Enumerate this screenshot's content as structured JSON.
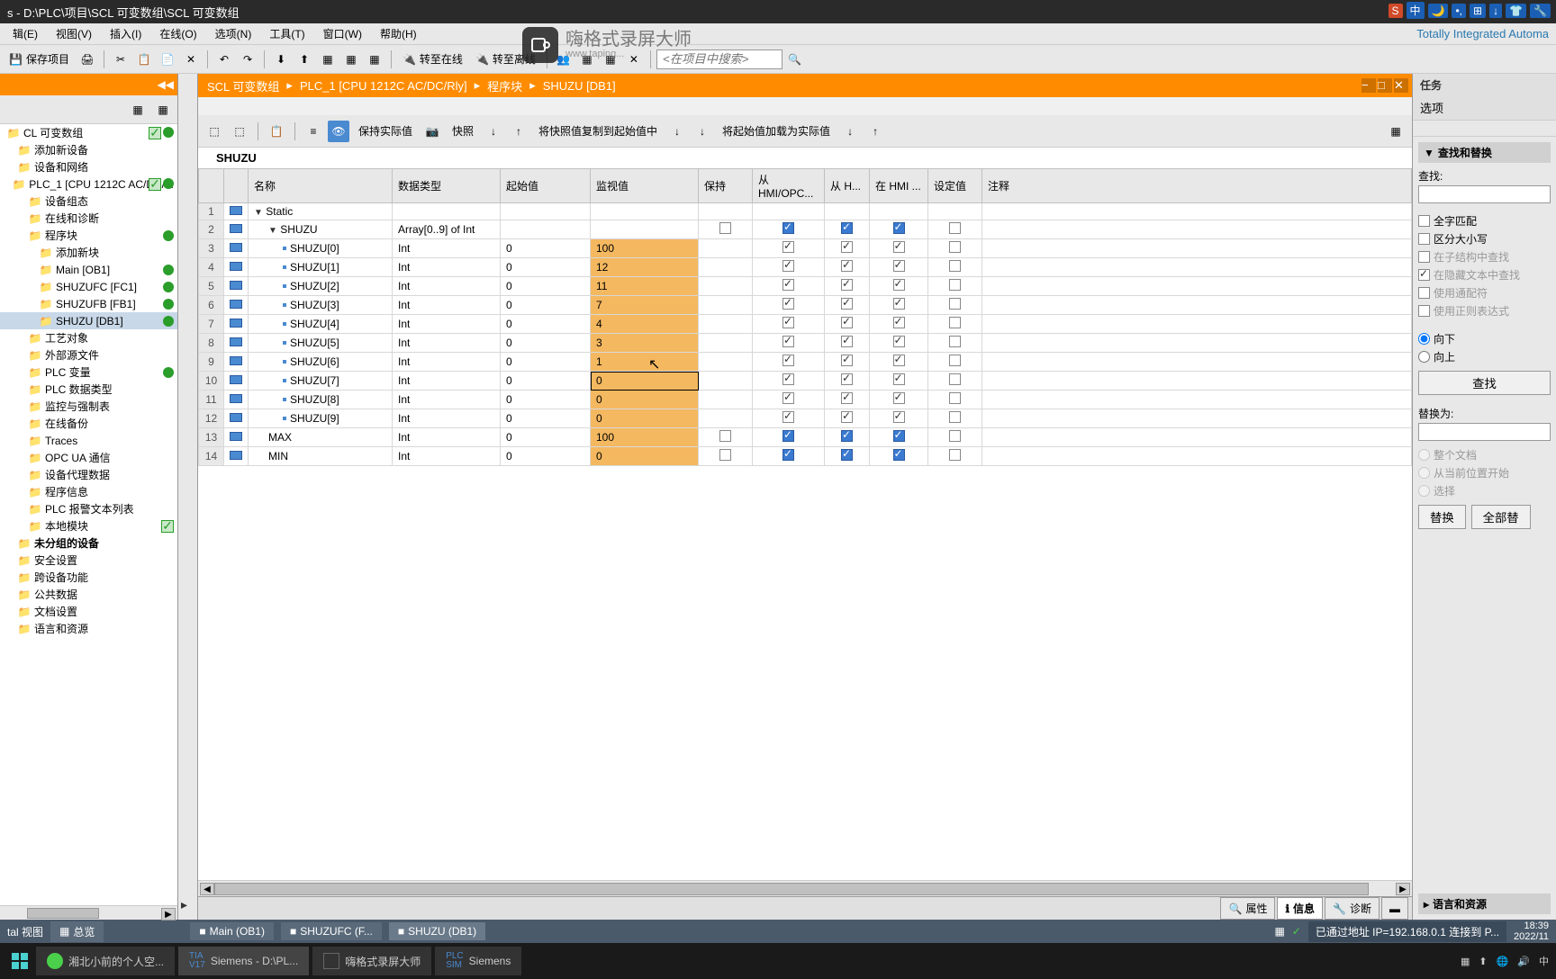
{
  "titlebar": {
    "text": "s - D:\\PLC\\项目\\SCL 可变数组\\SCL 可变数组"
  },
  "menubar": {
    "items": [
      "辑(E)",
      "视图(V)",
      "插入(I)",
      "在线(O)",
      "选项(N)",
      "工具(T)",
      "窗口(W)",
      "帮助(H)"
    ],
    "brand": "Totally Integrated Automa"
  },
  "toolbar": {
    "save": "保存项目",
    "go_online": "转至在线",
    "go_offline": "转至离线",
    "search_placeholder": "<在项目中搜索>"
  },
  "watermark": {
    "title": "嗨格式录屏大师",
    "sub": "www.taping..."
  },
  "breadcrumb": {
    "root": "SCL 可变数组",
    "plc": "PLC_1 [CPU 1212C AC/DC/Rly]",
    "blocks": "程序块",
    "db": "SHUZU [DB1]"
  },
  "editor_toolbar": {
    "keep_actual": "保持实际值",
    "snapshot": "快照",
    "copy_snapshot": "将快照值复制到起始值中",
    "load_start": "将起始值加载为实际值"
  },
  "db_name": "SHUZU",
  "grid": {
    "headers": {
      "name": "名称",
      "datatype": "数据类型",
      "startval": "起始值",
      "monitor": "监视值",
      "retain": "保持",
      "hmi_opc": "从 HMI/OPC...",
      "from_h": "从 H...",
      "in_hmi": "在 HMI ...",
      "setpoint": "设定值",
      "comment": "注释"
    },
    "rows": [
      {
        "n": 1,
        "name": "Static",
        "type": "",
        "start": "",
        "mon": "",
        "exp": "▼",
        "lvl": 0,
        "retain": "",
        "h1": "",
        "h2": "",
        "h3": "",
        "sp": ""
      },
      {
        "n": 2,
        "name": "SHUZU",
        "type": "Array[0..9] of Int",
        "start": "",
        "mon": "",
        "exp": "▼",
        "lvl": 1,
        "retain": "empty",
        "h1": "blue",
        "h2": "blue",
        "h3": "blue",
        "sp": "empty"
      },
      {
        "n": 3,
        "name": "SHUZU[0]",
        "type": "Int",
        "start": "0",
        "mon": "100",
        "lvl": 2,
        "retain": "",
        "h1": "check",
        "h2": "check",
        "h3": "check",
        "sp": "empty"
      },
      {
        "n": 4,
        "name": "SHUZU[1]",
        "type": "Int",
        "start": "0",
        "mon": "12",
        "lvl": 2,
        "retain": "",
        "h1": "check",
        "h2": "check",
        "h3": "check",
        "sp": "empty"
      },
      {
        "n": 5,
        "name": "SHUZU[2]",
        "type": "Int",
        "start": "0",
        "mon": "11",
        "lvl": 2,
        "retain": "",
        "h1": "check",
        "h2": "check",
        "h3": "check",
        "sp": "empty"
      },
      {
        "n": 6,
        "name": "SHUZU[3]",
        "type": "Int",
        "start": "0",
        "mon": "7",
        "lvl": 2,
        "retain": "",
        "h1": "check",
        "h2": "check",
        "h3": "check",
        "sp": "empty"
      },
      {
        "n": 7,
        "name": "SHUZU[4]",
        "type": "Int",
        "start": "0",
        "mon": "4",
        "lvl": 2,
        "retain": "",
        "h1": "check",
        "h2": "check",
        "h3": "check",
        "sp": "empty"
      },
      {
        "n": 8,
        "name": "SHUZU[5]",
        "type": "Int",
        "start": "0",
        "mon": "3",
        "lvl": 2,
        "retain": "",
        "h1": "check",
        "h2": "check",
        "h3": "check",
        "sp": "empty"
      },
      {
        "n": 9,
        "name": "SHUZU[6]",
        "type": "Int",
        "start": "0",
        "mon": "1",
        "lvl": 2,
        "retain": "",
        "h1": "check",
        "h2": "check",
        "h3": "check",
        "sp": "empty"
      },
      {
        "n": 10,
        "name": "SHUZU[7]",
        "type": "Int",
        "start": "0",
        "mon": "0",
        "lvl": 2,
        "sel": true,
        "retain": "",
        "h1": "check",
        "h2": "check",
        "h3": "check",
        "sp": "empty"
      },
      {
        "n": 11,
        "name": "SHUZU[8]",
        "type": "Int",
        "start": "0",
        "mon": "0",
        "lvl": 2,
        "retain": "",
        "h1": "check",
        "h2": "check",
        "h3": "check",
        "sp": "empty"
      },
      {
        "n": 12,
        "name": "SHUZU[9]",
        "type": "Int",
        "start": "0",
        "mon": "0",
        "lvl": 2,
        "retain": "",
        "h1": "check",
        "h2": "check",
        "h3": "check",
        "sp": "empty"
      },
      {
        "n": 13,
        "name": "MAX",
        "type": "Int",
        "start": "0",
        "mon": "100",
        "lvl": 1,
        "retain": "empty",
        "h1": "blue",
        "h2": "blue",
        "h3": "blue",
        "sp": "empty"
      },
      {
        "n": 14,
        "name": "MIN",
        "type": "Int",
        "start": "0",
        "mon": "0",
        "lvl": 1,
        "retain": "empty",
        "h1": "blue",
        "h2": "blue",
        "h3": "blue",
        "sp": "empty"
      }
    ]
  },
  "tree": {
    "items": [
      {
        "label": "CL 可变数组",
        "lvl": 0,
        "icon": "folder",
        "check": true,
        "dot": true
      },
      {
        "label": "添加新设备",
        "lvl": 1,
        "icon": "add"
      },
      {
        "label": "设备和网络",
        "lvl": 1,
        "icon": "net"
      },
      {
        "label": "PLC_1 [CPU 1212C AC/DC/...",
        "lvl": 1,
        "icon": "plc",
        "check": true,
        "dot": true
      },
      {
        "label": "设备组态",
        "lvl": 2,
        "icon": "dev"
      },
      {
        "label": "在线和诊断",
        "lvl": 2,
        "icon": "diag"
      },
      {
        "label": "程序块",
        "lvl": 2,
        "icon": "folder",
        "dot": true
      },
      {
        "label": "添加新块",
        "lvl": 3,
        "icon": "add"
      },
      {
        "label": "Main [OB1]",
        "lvl": 3,
        "icon": "ob",
        "dot": true
      },
      {
        "label": "SHUZUFC [FC1]",
        "lvl": 3,
        "icon": "fc",
        "dot": true
      },
      {
        "label": "SHUZUFB [FB1]",
        "lvl": 3,
        "icon": "fb",
        "dot": true
      },
      {
        "label": "SHUZU [DB1]",
        "lvl": 3,
        "icon": "db",
        "sel": true,
        "dot": true
      },
      {
        "label": "工艺对象",
        "lvl": 2,
        "icon": "folder"
      },
      {
        "label": "外部源文件",
        "lvl": 2,
        "icon": "folder"
      },
      {
        "label": "PLC 变量",
        "lvl": 2,
        "icon": "folder",
        "dot": true
      },
      {
        "label": "PLC 数据类型",
        "lvl": 2,
        "icon": "folder"
      },
      {
        "label": "监控与强制表",
        "lvl": 2,
        "icon": "folder"
      },
      {
        "label": "在线备份",
        "lvl": 2,
        "icon": "folder"
      },
      {
        "label": "Traces",
        "lvl": 2,
        "icon": "folder"
      },
      {
        "label": "OPC UA 通信",
        "lvl": 2,
        "icon": "folder"
      },
      {
        "label": "设备代理数据",
        "lvl": 2,
        "icon": "folder"
      },
      {
        "label": "程序信息",
        "lvl": 2,
        "icon": "info"
      },
      {
        "label": "PLC 报警文本列表",
        "lvl": 2,
        "icon": "alarm"
      },
      {
        "label": "本地模块",
        "lvl": 2,
        "icon": "folder",
        "check": true
      },
      {
        "label": "未分组的设备",
        "lvl": 1,
        "icon": "folder",
        "bold": true
      },
      {
        "label": "安全设置",
        "lvl": 1,
        "icon": "folder"
      },
      {
        "label": "跨设备功能",
        "lvl": 1,
        "icon": "folder"
      },
      {
        "label": "公共数据",
        "lvl": 1,
        "icon": "folder"
      },
      {
        "label": "文档设置",
        "lvl": 1,
        "icon": "folder"
      },
      {
        "label": "语言和资源",
        "lvl": 1,
        "icon": "folder"
      }
    ]
  },
  "right": {
    "tasks": "任务",
    "options": "选项",
    "find_replace": "查找和替换",
    "find_label": "查找:",
    "match_whole": "全字匹配",
    "match_case": "区分大小写",
    "sub_struct": "在子结构中查找",
    "hidden_text": "在隐藏文本中查找",
    "wildcard": "使用通配符",
    "regex": "使用正则表达式",
    "dir_down": "向下",
    "dir_up": "向上",
    "find_btn": "查找",
    "replace_label": "替换为:",
    "whole_doc": "整个文档",
    "from_pos": "从当前位置开始",
    "selection": "选择",
    "replace_btn": "替换",
    "replace_all": "全部替",
    "lang_res": "语言和资源"
  },
  "info_tabs": {
    "props": "属性",
    "info": "信息",
    "diag": "诊断"
  },
  "footer": {
    "view_label": "tal 视图",
    "overview": "总览",
    "tabs": [
      "Main (OB1)",
      "SHUZUFC (F...",
      "SHUZU (DB1)"
    ],
    "status": "已通过地址 IP=192.168.0.1 连接到 P...",
    "time": "18:39",
    "date": "2022/11"
  },
  "taskbar": {
    "items": [
      "湘北小前的个人空...",
      "Siemens - D:\\PL...",
      "嗨格式录屏大师",
      "Siemens"
    ],
    "ime": "中"
  }
}
